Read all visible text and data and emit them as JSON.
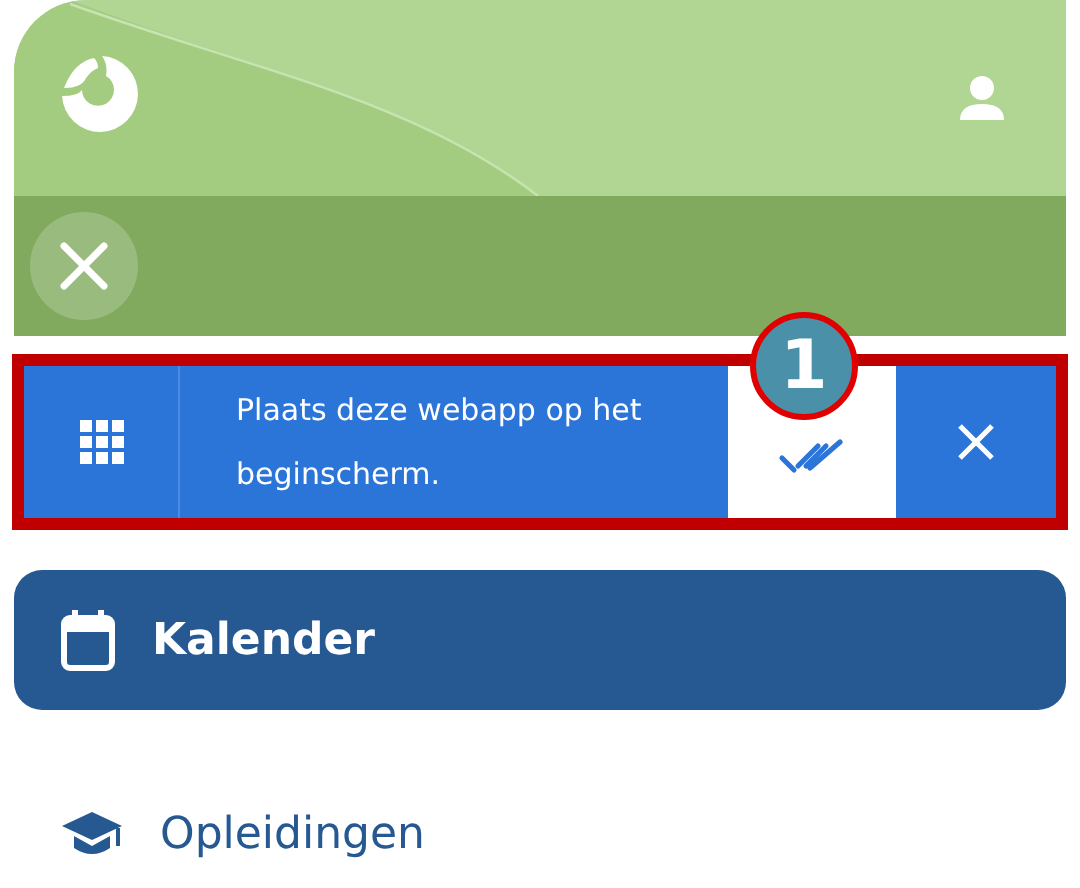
{
  "install_banner": {
    "message": "Plaats deze webapp op het beginscherm.",
    "callout": "1"
  },
  "nav_items": [
    {
      "label": "Kalender",
      "kind": "calendar",
      "selected": true
    },
    {
      "label": "Opleidingen",
      "kind": "education",
      "selected": false
    }
  ]
}
